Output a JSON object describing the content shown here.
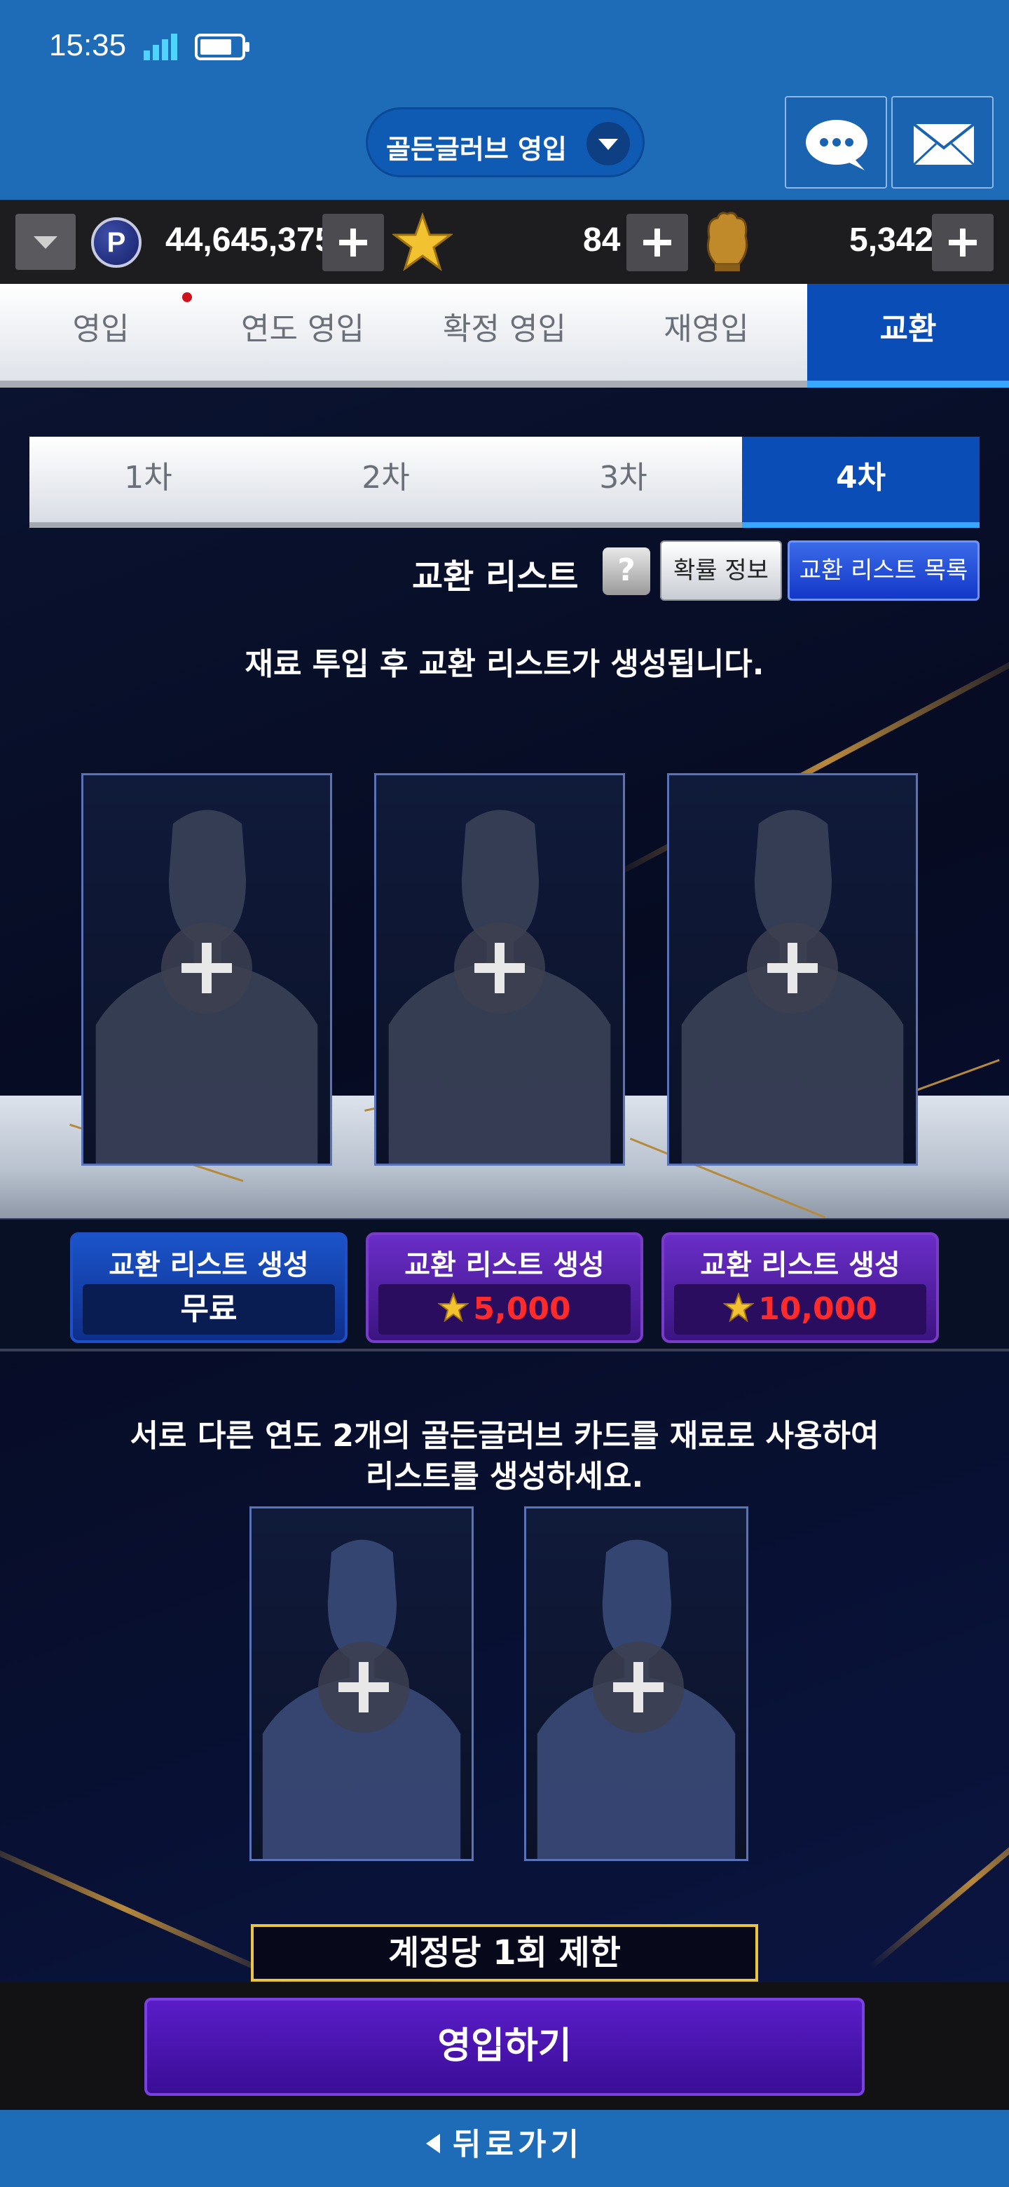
{
  "status": {
    "time": "15:35"
  },
  "header": {
    "title": "골든글러브 영입",
    "chat_icon": "chat-bubble-icon",
    "mail_icon": "envelope-icon"
  },
  "currency": {
    "points": "44,645,375",
    "stars": "84",
    "gloves": "5,342",
    "point_icon_label": "P"
  },
  "main_tabs": [
    {
      "label": "영입"
    },
    {
      "label": "연도 영입"
    },
    {
      "label": "확정 영입"
    },
    {
      "label": "재영입"
    },
    {
      "label": "교환",
      "active": true
    }
  ],
  "sub_tabs": [
    {
      "label": "1차"
    },
    {
      "label": "2차"
    },
    {
      "label": "3차"
    },
    {
      "label": "4차",
      "active": true
    }
  ],
  "exchange": {
    "title": "교환 리스트",
    "help": "?",
    "prob_info": "확률 정보",
    "list_button": "교환 리스트 목록",
    "notice": "재료 투입 후 교환 리스트가 생성됩니다."
  },
  "generate_buttons": [
    {
      "title": "교환 리스트 생성",
      "cost": "무료",
      "style": "blue"
    },
    {
      "title": "교환 리스트 생성",
      "cost": "5,000",
      "style": "purple"
    },
    {
      "title": "교환 리스트 생성",
      "cost": "10,000",
      "style": "purple"
    }
  ],
  "material": {
    "notice_line1": "서로 다른 연도 2개의 골든글러브 카드를 재료로 사용하여",
    "notice_line2": "리스트를 생성하세요.",
    "limit": "계정당 1회 제한"
  },
  "actions": {
    "enter": "영입하기",
    "back": "뒤로가기"
  },
  "colors": {
    "primary_blue": "#1e6bb8",
    "active_tab": "#0b4db6",
    "purple": "#5a1dc8",
    "cost_red": "#ff2a2a",
    "limit_border": "#e9c640"
  }
}
